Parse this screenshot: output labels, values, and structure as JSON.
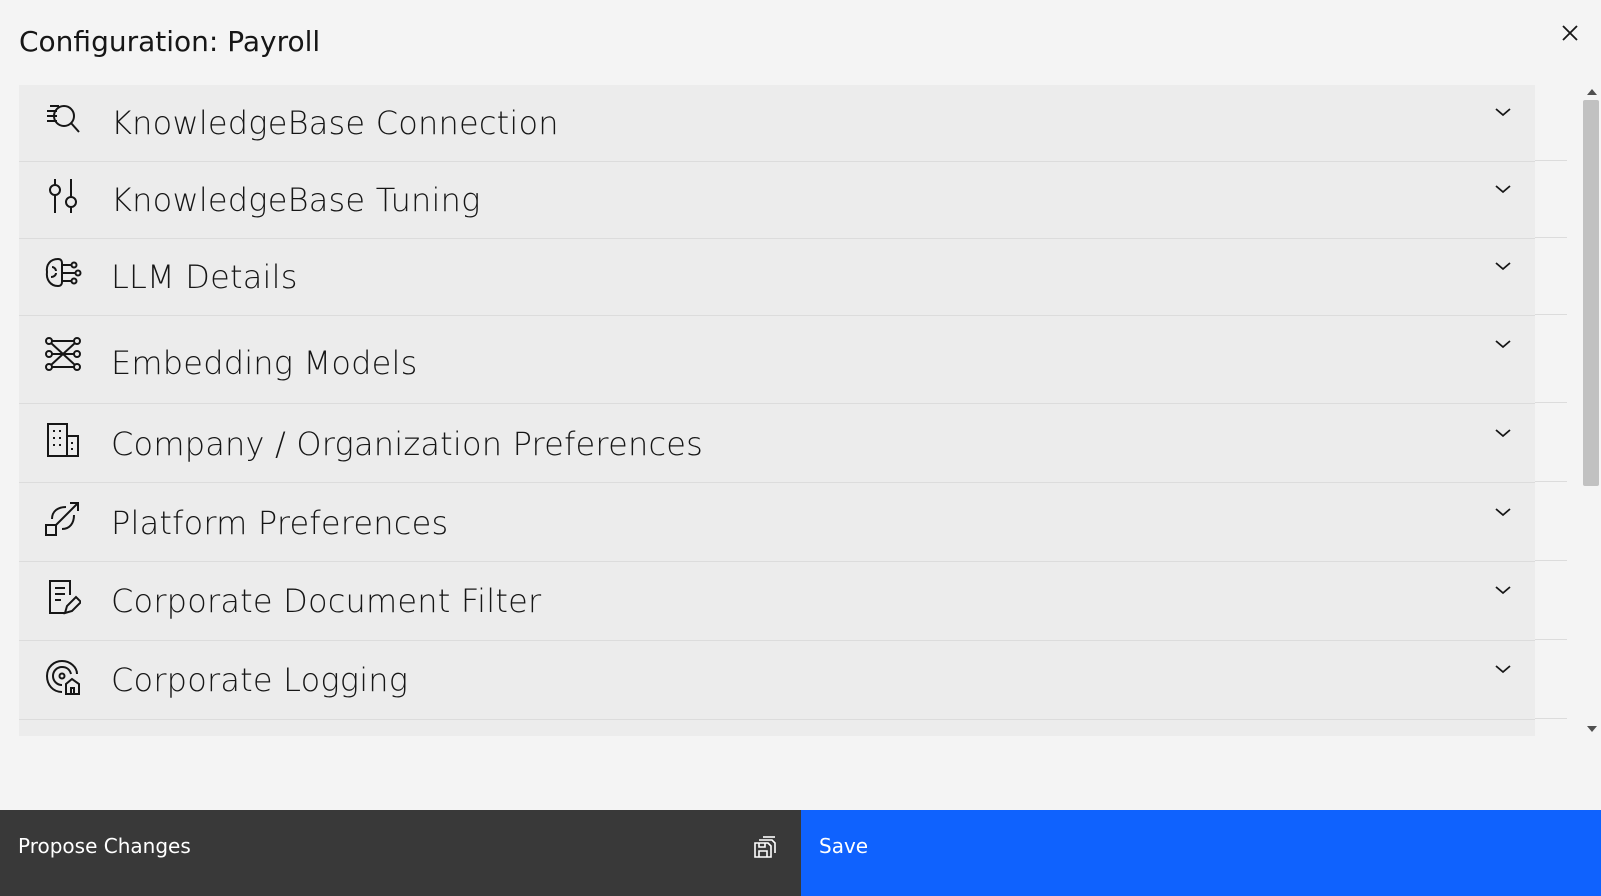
{
  "modal": {
    "title": "Configuration: Payroll",
    "close_icon": "close-icon"
  },
  "accordion": {
    "items": [
      {
        "label": "KnowledgeBase Connection",
        "icon": "search-list-icon",
        "expanded": false
      },
      {
        "label": "KnowledgeBase Tuning",
        "icon": "settings-adjust-icon",
        "expanded": false
      },
      {
        "label": "LLM Details",
        "icon": "ai-brain-icon",
        "expanded": false
      },
      {
        "label": "Embedding Models",
        "icon": "network-icon",
        "expanded": false
      },
      {
        "label": "Company / Organization Preferences",
        "icon": "building-icon",
        "expanded": false
      },
      {
        "label": "Platform Preferences",
        "icon": "platform-icon",
        "expanded": false
      },
      {
        "label": "Corporate Document Filter",
        "icon": "document-edit-icon",
        "expanded": false
      },
      {
        "label": "Corporate Logging",
        "icon": "logging-icon",
        "expanded": false
      }
    ]
  },
  "footer": {
    "secondary_label": "Propose Changes",
    "secondary_icon": "save-series-icon",
    "primary_label": "Save"
  },
  "colors": {
    "background": "#f4f4f4",
    "accordion_row": "#ececec",
    "primary": "#0f62fe",
    "secondary": "#393939",
    "text": "#161616"
  }
}
